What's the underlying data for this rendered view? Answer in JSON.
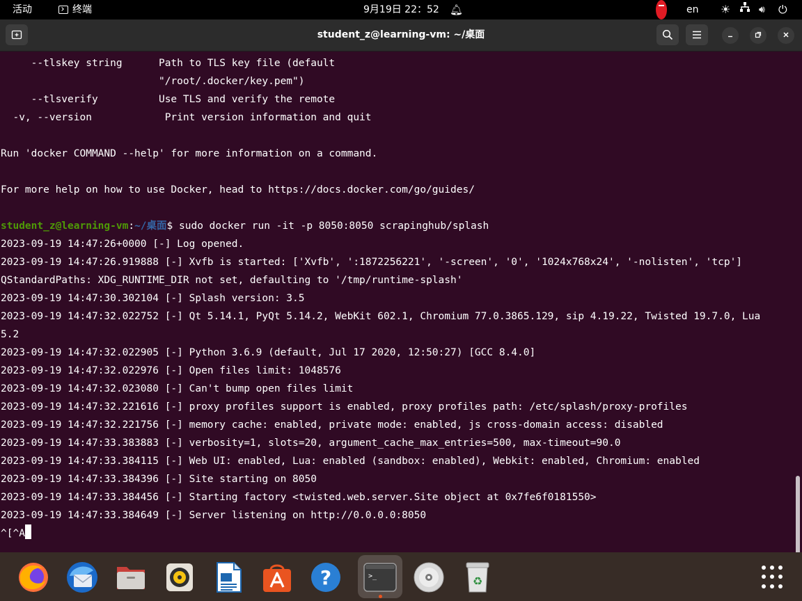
{
  "topbar": {
    "activities": "活动",
    "app_name": "终端",
    "clock": "9月19日  22：52",
    "language": "en"
  },
  "window": {
    "title": "student_z@learning-vm: ~/桌面"
  },
  "terminal": {
    "lines": [
      "     --tlskey string      Path to TLS key file (default",
      "                          \"/root/.docker/key.pem\")",
      "     --tlsverify          Use TLS and verify the remote",
      "  -v, --version            Print version information and quit",
      "",
      "Run 'docker COMMAND --help' for more information on a command.",
      "",
      "For more help on how to use Docker, head to https://docs.docker.com/go/guides/",
      ""
    ],
    "prompt": {
      "user_host": "student_z@learning-vm",
      "sep": ":",
      "path": "~/桌面",
      "dollar": "$ ",
      "command": "sudo docker run -it -p 8050:8050 scrapinghub/splash"
    },
    "log_lines": [
      "2023-09-19 14:47:26+0000 [-] Log opened.",
      "2023-09-19 14:47:26.919888 [-] Xvfb is started: ['Xvfb', ':1872256221', '-screen', '0', '1024x768x24', '-nolisten', 'tcp']",
      "QStandardPaths: XDG_RUNTIME_DIR not set, defaulting to '/tmp/runtime-splash'",
      "2023-09-19 14:47:30.302104 [-] Splash version: 3.5",
      "2023-09-19 14:47:32.022752 [-] Qt 5.14.1, PyQt 5.14.2, WebKit 602.1, Chromium 77.0.3865.129, sip 4.19.22, Twisted 19.7.0, Lua",
      "5.2",
      "2023-09-19 14:47:32.022905 [-] Python 3.6.9 (default, Jul 17 2020, 12:50:27) [GCC 8.4.0]",
      "2023-09-19 14:47:32.022976 [-] Open files limit: 1048576",
      "2023-09-19 14:47:32.023080 [-] Can't bump open files limit",
      "2023-09-19 14:47:32.221616 [-] proxy profiles support is enabled, proxy profiles path: /etc/splash/proxy-profiles",
      "2023-09-19 14:47:32.221756 [-] memory cache: enabled, private mode: enabled, js cross-domain access: disabled",
      "2023-09-19 14:47:33.383883 [-] verbosity=1, slots=20, argument_cache_max_entries=500, max-timeout=90.0",
      "2023-09-19 14:47:33.384115 [-] Web UI: enabled, Lua: enabled (sandbox: enabled), Webkit: enabled, Chromium: enabled",
      "2023-09-19 14:47:33.384396 [-] Site starting on 8050",
      "2023-09-19 14:47:33.384456 [-] Starting factory <twisted.web.server.Site object at 0x7fe6f0181550>",
      "2023-09-19 14:47:33.384649 [-] Server listening on http://0.0.0.0:8050"
    ],
    "last_input": "^[^A"
  },
  "dock": {
    "items": [
      "firefox-icon",
      "thunderbird-icon",
      "files-icon",
      "rhythmbox-icon",
      "libreoffice-writer-icon",
      "app-center-icon",
      "help-icon",
      "terminal-icon",
      "disc-icon",
      "trash-icon"
    ]
  },
  "colors": {
    "terminal_bg": "#300a24",
    "prompt_user": "#4e9a06",
    "prompt_path": "#3465a4",
    "headerbar": "#2c2c2c",
    "accent": "#e95420"
  }
}
